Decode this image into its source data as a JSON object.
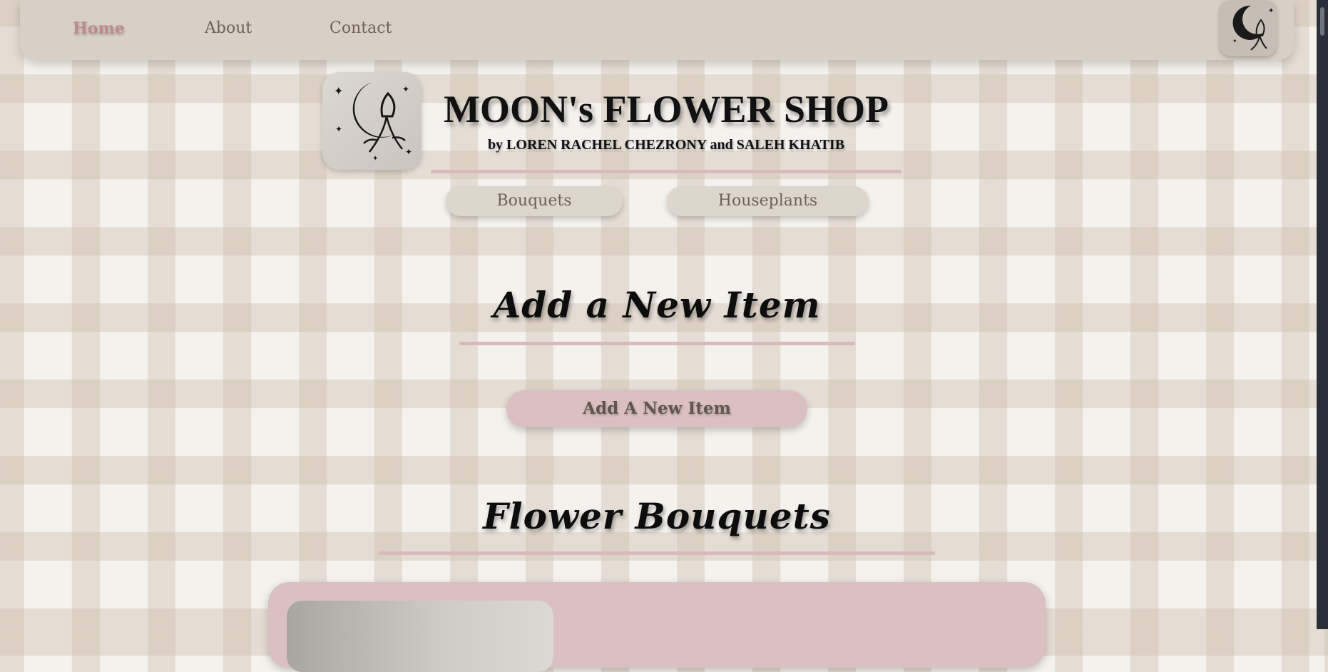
{
  "nav": {
    "links": [
      {
        "label": "Home",
        "active": true
      },
      {
        "label": "About",
        "active": false
      },
      {
        "label": "Contact",
        "active": false
      }
    ],
    "avatar_icon": "moon-flower-icon"
  },
  "header": {
    "title": "MOON's FLOWER SHOP",
    "subtitle": "by LOREN RACHEL CHEZRONY and SALEH KHATIB",
    "logo_icon": "moon-flower-logo"
  },
  "categories": [
    "Bouquets",
    "Houseplants"
  ],
  "add_section": {
    "heading": "Add a New Item",
    "button_label": "Add A New Item"
  },
  "bouquets_section": {
    "heading": "Flower Bouquets"
  },
  "colors": {
    "accent_pink": "#dbc0c1",
    "active_link": "#bf8a8e",
    "nav_bg": "#d8d0c4",
    "divider": "#d9b9bb"
  }
}
